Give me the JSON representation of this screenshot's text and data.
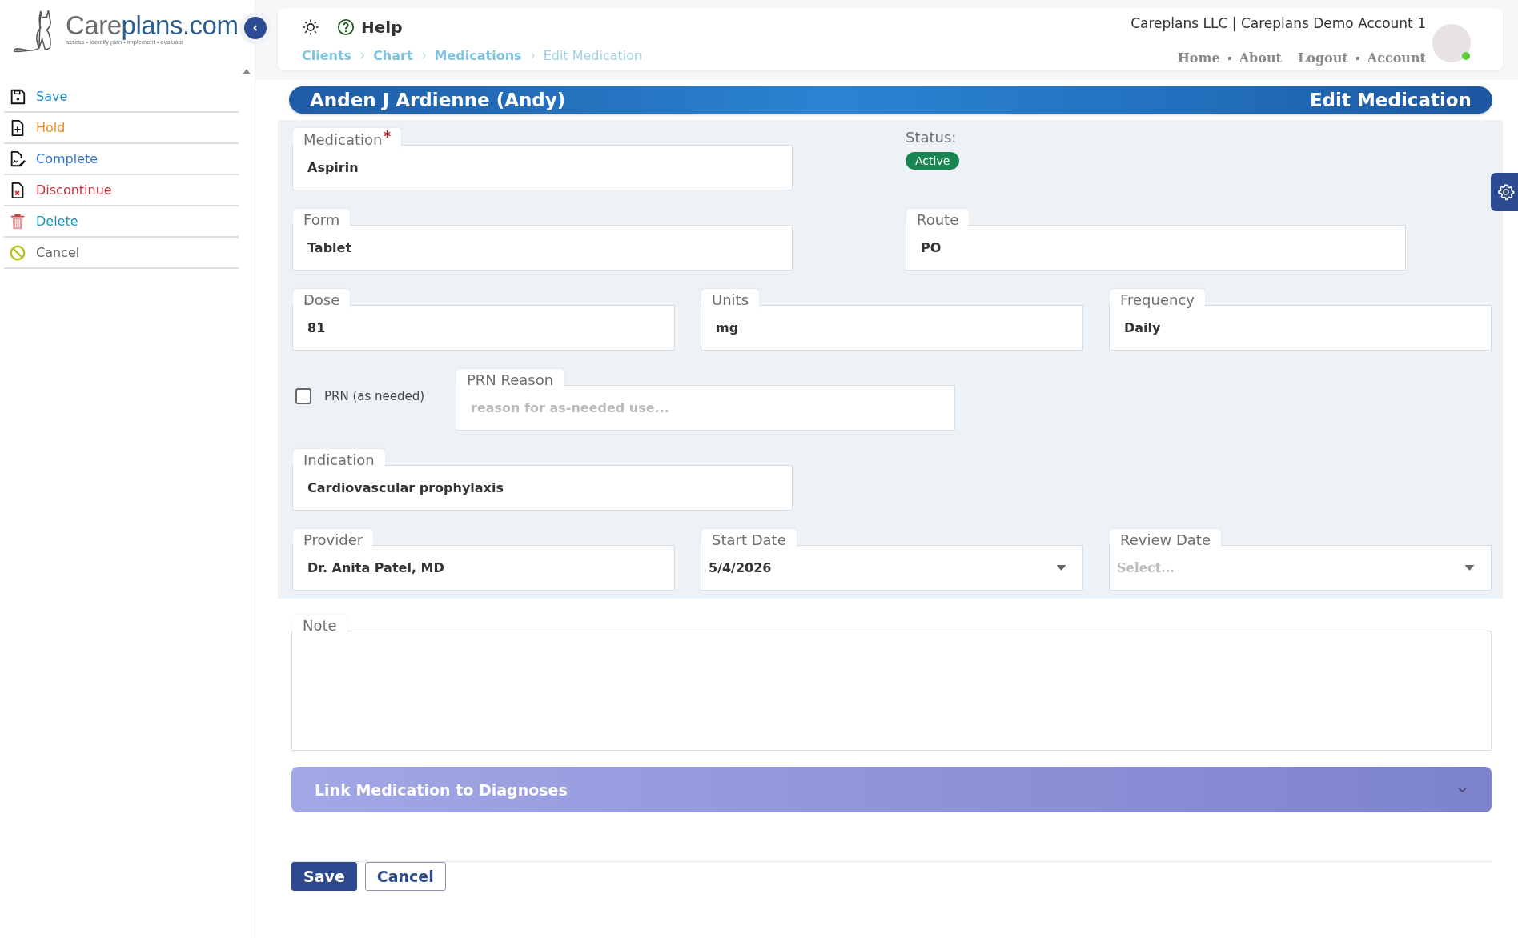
{
  "logo": {
    "name_a": "Care",
    "name_b": "plans.com",
    "tagline": "assess • identify plan • implement • evaluate"
  },
  "sidebar": {
    "actions": [
      {
        "label": "Save",
        "kind": "save"
      },
      {
        "label": "Hold",
        "kind": "hold"
      },
      {
        "label": "Complete",
        "kind": "complete"
      },
      {
        "label": "Discontinue",
        "kind": "discontinue"
      },
      {
        "label": "Delete",
        "kind": "delete"
      },
      {
        "label": "Cancel",
        "kind": "cancel"
      }
    ]
  },
  "header": {
    "help": "Help",
    "breadcrumbs": [
      {
        "label": "Clients",
        "current": false
      },
      {
        "label": "Chart",
        "current": false
      },
      {
        "label": "Medications",
        "current": false
      },
      {
        "label": "Edit Medication",
        "current": true
      }
    ],
    "account": "Careplans LLC | Careplans Demo Account 1",
    "link_groups": [
      [
        "Home",
        "About"
      ],
      [
        "Logout",
        "Account"
      ]
    ],
    "user": {
      "online": true
    }
  },
  "title": {
    "patient": "Anden J Ardienne (Andy)",
    "page": "Edit Medication"
  },
  "form": {
    "rows": [
      {
        "items": [
          {
            "kind": "text",
            "label": "Medication",
            "value": "Aspirin",
            "required": true
          },
          {
            "kind": "status",
            "label": "Status:",
            "value": "Active"
          }
        ]
      },
      {
        "items": [
          {
            "kind": "text",
            "label": "Form",
            "value": "Tablet",
            "required": false
          },
          {
            "kind": "text",
            "label": "Route",
            "value": "PO",
            "required": false
          }
        ]
      },
      {
        "items": [
          {
            "kind": "text",
            "label": "Dose",
            "value": "81",
            "required": false
          },
          {
            "kind": "text",
            "label": "Units",
            "value": "mg",
            "required": false
          },
          {
            "kind": "text",
            "label": "Frequency",
            "value": "Daily",
            "required": false
          }
        ]
      },
      {
        "items": [
          {
            "kind": "checkbox",
            "label": "PRN (as needed)",
            "checked": false
          },
          {
            "kind": "text",
            "label": "PRN Reason",
            "placeholder": "reason for as-needed use...",
            "required": false
          }
        ]
      },
      {
        "items": [
          {
            "kind": "text",
            "label": "Indication",
            "value": "Cardiovascular prophylaxis",
            "required": false
          }
        ]
      },
      {
        "items": [
          {
            "kind": "text",
            "label": "Provider",
            "value": "Dr. Anita Patel, MD",
            "required": false
          },
          {
            "kind": "select",
            "label": "Start Date",
            "value": "5/4/2026",
            "required": false
          },
          {
            "kind": "select",
            "label": "Review Date",
            "placeholder": "Select...",
            "required": false
          }
        ]
      }
    ]
  },
  "note": {
    "label": "Note"
  },
  "link_section": {
    "title": "Link Medication to Diagnoses",
    "expanded": false
  },
  "buttons": [
    {
      "label": "Save",
      "kind": "primary"
    },
    {
      "label": "Cancel",
      "kind": "secondary"
    }
  ]
}
